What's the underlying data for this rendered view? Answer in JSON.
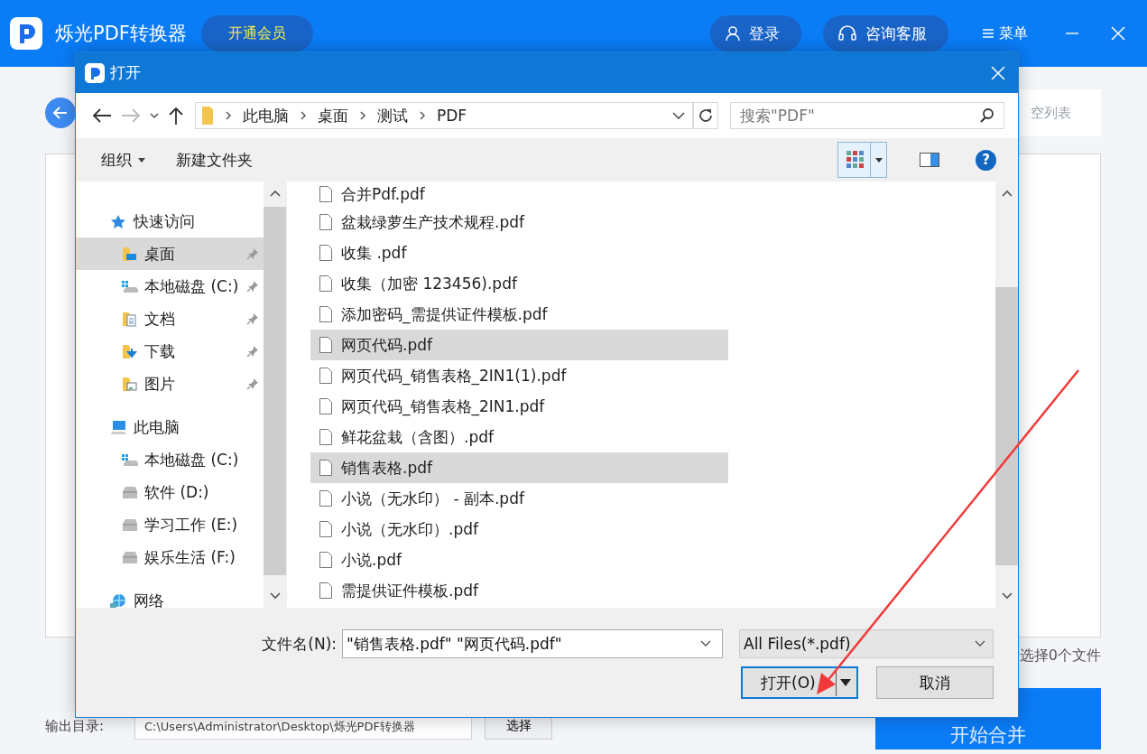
{
  "app": {
    "title": "烁光PDF转换器",
    "vip_button": "开通会员",
    "login_button": "登录",
    "service_button": "咨询客服",
    "menu_button": "菜单"
  },
  "page": {
    "clear_list": "空列表",
    "selected_count": "选择0个文件",
    "output_label": "输出目录:",
    "output_path": "C:\\Users\\Administrator\\Desktop\\烁光PDF转换器",
    "choose_button": "选择",
    "start_button": "开始合并"
  },
  "dialog": {
    "title": "打开",
    "breadcrumb": [
      "此电脑",
      "桌面",
      "测试",
      "PDF"
    ],
    "search": {
      "placeholder": "搜索\"PDF\""
    },
    "toolbar": {
      "organize": "组织",
      "new_folder": "新建文件夹",
      "help": "?"
    },
    "sidebar": {
      "items": [
        {
          "label": "快速访问",
          "kind": "star",
          "children": [
            {
              "label": "桌面",
              "kind": "desktop",
              "pinned": true,
              "selected": true
            },
            {
              "label": "本地磁盘 (C:)",
              "kind": "windrive",
              "pinned": true,
              "selected": false
            },
            {
              "label": "文档",
              "kind": "docs",
              "pinned": true,
              "selected": false
            },
            {
              "label": "下载",
              "kind": "download",
              "pinned": true,
              "selected": false
            },
            {
              "label": "图片",
              "kind": "pictures",
              "pinned": true,
              "selected": false
            }
          ]
        },
        {
          "label": "此电脑",
          "kind": "pc",
          "children": [
            {
              "label": "本地磁盘 (C:)",
              "kind": "windrive",
              "pinned": false,
              "selected": false
            },
            {
              "label": "软件 (D:)",
              "kind": "drive",
              "pinned": false,
              "selected": false
            },
            {
              "label": "学习工作 (E:)",
              "kind": "drive",
              "pinned": false,
              "selected": false
            },
            {
              "label": "娱乐生活 (F:)",
              "kind": "drive",
              "pinned": false,
              "selected": false
            }
          ]
        },
        {
          "label": "网络",
          "kind": "network"
        }
      ]
    },
    "files": [
      {
        "name": "合并Pdf.pdf",
        "selected": false
      },
      {
        "name": "盆栽绿萝生产技术规程.pdf",
        "selected": false
      },
      {
        "name": "收集 .pdf",
        "selected": false
      },
      {
        "name": "收集（加密 123456).pdf",
        "selected": false
      },
      {
        "name": "添加密码_需提供证件模板.pdf",
        "selected": false
      },
      {
        "name": "网页代码.pdf",
        "selected": true
      },
      {
        "name": "网页代码_销售表格_2IN1(1).pdf",
        "selected": false
      },
      {
        "name": "网页代码_销售表格_2IN1.pdf",
        "selected": false
      },
      {
        "name": "鲜花盆栽（含图）.pdf",
        "selected": false
      },
      {
        "name": "销售表格.pdf",
        "selected": true
      },
      {
        "name": "小说（无水印） - 副本.pdf",
        "selected": false
      },
      {
        "name": "小说（无水印）.pdf",
        "selected": false
      },
      {
        "name": "小说.pdf",
        "selected": false
      },
      {
        "name": "需提供证件模板.pdf",
        "selected": false
      }
    ],
    "filename_label": "文件名(N):",
    "filename_value": "\"销售表格.pdf\" \"网页代码.pdf\"",
    "filter": "All Files(*.pdf)",
    "open_button": "打开(O)",
    "cancel_button": "取消"
  }
}
